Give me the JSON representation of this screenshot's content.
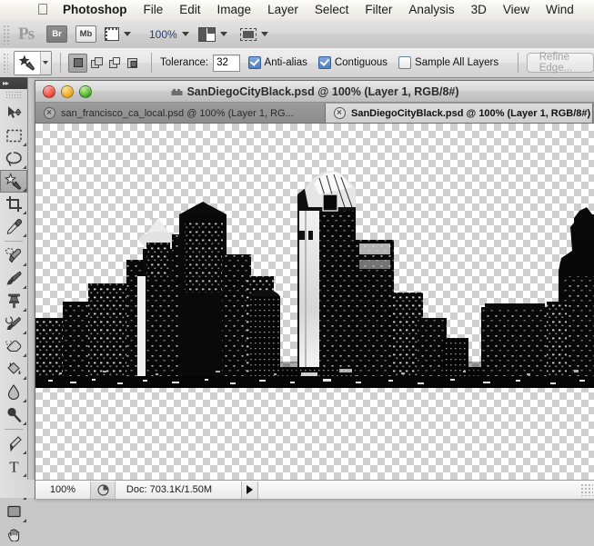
{
  "menubar": {
    "apple_icon": "apple-logo-icon",
    "items": [
      {
        "label": "Photoshop",
        "bold": true
      },
      {
        "label": "File",
        "bold": false
      },
      {
        "label": "Edit",
        "bold": false
      },
      {
        "label": "Image",
        "bold": false
      },
      {
        "label": "Layer",
        "bold": false
      },
      {
        "label": "Select",
        "bold": false
      },
      {
        "label": "Filter",
        "bold": false
      },
      {
        "label": "Analysis",
        "bold": false
      },
      {
        "label": "3D",
        "bold": false
      },
      {
        "label": "View",
        "bold": false
      },
      {
        "label": "Wind",
        "bold": false
      }
    ]
  },
  "appbar": {
    "ps_logo": "Ps",
    "bridge_label": "Br",
    "minibridge_label": "Mb",
    "view_extras_icon": "view-extras-icon",
    "zoom_level": "100%",
    "arrange_documents_icon": "arrange-documents-icon",
    "screen_mode_icon": "screen-mode-icon"
  },
  "options": {
    "tool_icon": "magic-wand-icon",
    "selection_modes": [
      "new-selection",
      "add-to-selection",
      "subtract-from-selection",
      "intersect-with-selection"
    ],
    "tolerance_label": "Tolerance:",
    "tolerance_value": "32",
    "antialias_label": "Anti-alias",
    "antialias_checked": true,
    "contiguous_label": "Contiguous",
    "contiguous_checked": true,
    "sample_all_layers_label": "Sample All Layers",
    "sample_all_layers_checked": false,
    "refine_edge_label": "Refine Edge...",
    "refine_edge_enabled": false
  },
  "tools": [
    {
      "name": "move-tool",
      "selected": false,
      "has_flyout": false
    },
    {
      "name": "rectangular-marquee-tool",
      "selected": false,
      "has_flyout": true
    },
    {
      "name": "lasso-tool",
      "selected": false,
      "has_flyout": true
    },
    {
      "name": "magic-wand-tool",
      "selected": true,
      "has_flyout": true
    },
    {
      "name": "crop-tool",
      "selected": false,
      "has_flyout": true
    },
    {
      "name": "eyedropper-tool",
      "selected": false,
      "has_flyout": true
    },
    {
      "name": "spot-healing-brush-tool",
      "selected": false,
      "has_flyout": true
    },
    {
      "name": "brush-tool",
      "selected": false,
      "has_flyout": true
    },
    {
      "name": "clone-stamp-tool",
      "selected": false,
      "has_flyout": true
    },
    {
      "name": "history-brush-tool",
      "selected": false,
      "has_flyout": true
    },
    {
      "name": "eraser-tool",
      "selected": false,
      "has_flyout": true
    },
    {
      "name": "paint-bucket-tool",
      "selected": false,
      "has_flyout": true
    },
    {
      "name": "blur-tool",
      "selected": false,
      "has_flyout": true
    },
    {
      "name": "dodge-tool",
      "selected": false,
      "has_flyout": true
    },
    {
      "name": "pen-tool",
      "selected": false,
      "has_flyout": true
    },
    {
      "name": "type-tool",
      "selected": false,
      "has_flyout": true
    },
    {
      "name": "path-selection-tool",
      "selected": false,
      "has_flyout": true
    },
    {
      "name": "rectangle-shape-tool",
      "selected": false,
      "has_flyout": true
    }
  ],
  "document_window": {
    "title": "SanDiegoCityBlack.psd @ 100% (Layer 1, RGB/8#)",
    "traffic_lights": [
      "close-button",
      "minimize-button",
      "zoom-button"
    ],
    "tabs": [
      {
        "label": "san_francisco_ca_local.psd @ 100% (Layer 1, RG...",
        "active": false
      },
      {
        "label": "SanDiegoCityBlack.psd @ 100% (Layer 1, RGB/8#)",
        "active": true
      }
    ]
  },
  "statusbar": {
    "zoom": "100%",
    "doc_icon": "document-info-icon",
    "doc_size": "Doc: 703.1K/1.50M",
    "popup_arrow_icon": "status-popup-arrow-icon",
    "resize_grip_icon": "resize-grip-icon"
  },
  "artwork": {
    "description": "San Diego city skyline silhouette, high-contrast black and white on transparent background",
    "silhouette_color": "#060606",
    "highlight_color": "#ffffff"
  }
}
